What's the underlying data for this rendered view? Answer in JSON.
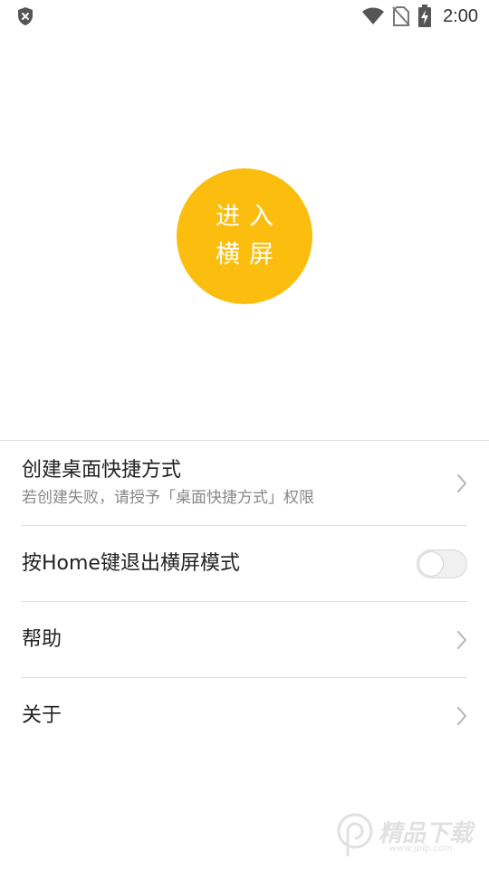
{
  "status_bar": {
    "time": "2:00",
    "left_icon": "shield-x-icon",
    "right_icons": [
      "wifi-icon",
      "no-sim-icon",
      "battery-charging-icon"
    ]
  },
  "hero": {
    "button_line1": "进入",
    "button_line2": "横屏",
    "button_color": "#FBBE0E"
  },
  "settings": {
    "items": [
      {
        "title": "创建桌面快捷方式",
        "subtitle": "若创建失败，请授予「桌面快捷方式」权限",
        "control": "chevron"
      },
      {
        "title": "按Home键退出横屏模式",
        "control": "toggle",
        "toggle_on": false
      },
      {
        "title": "帮助",
        "control": "chevron"
      },
      {
        "title": "关于",
        "control": "chevron"
      }
    ]
  },
  "watermark": {
    "text": "精品下载",
    "url": "www.jplp.com"
  }
}
